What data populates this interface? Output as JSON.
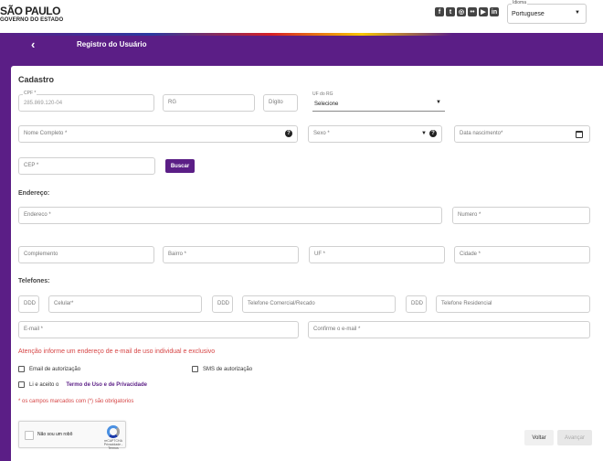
{
  "header": {
    "logo_line1": "SÃO PAULO",
    "logo_line2": "GOVERNO DO ESTADO",
    "social_icons": [
      "facebook-icon",
      "twitter-icon",
      "instagram-icon",
      "flickr-icon",
      "youtube-icon",
      "linkedin-icon"
    ],
    "language_label": "Idioma",
    "language_value": "Portuguese"
  },
  "titlebar": {
    "back_glyph": "‹",
    "title": "Registro do Usuário"
  },
  "form": {
    "heading": "Cadastro",
    "cpf_label": "CPF *",
    "cpf_value": "285.869.120-04",
    "rg_placeholder": "RG",
    "digito_placeholder": "Dígito",
    "uf_rg_label": "UF do RG",
    "uf_rg_value": "Selecione",
    "nome_placeholder": "Nome Completo *",
    "sexo_placeholder": "Sexo *",
    "nascimento_placeholder": "Data nascimento*",
    "cep_placeholder": "CEP *",
    "buscar_label": "Buscar",
    "endereco_heading": "Endereço:",
    "endereco_placeholder": "Endereco *",
    "numero_placeholder": "Numero *",
    "complemento_placeholder": "Complemento",
    "bairro_placeholder": "Bairro *",
    "uf_placeholder": "UF *",
    "cidade_placeholder": "Cidade *",
    "telefones_heading": "Telefones:",
    "ddd_placeholder": "DDD",
    "celular_placeholder": "Celular*",
    "comercial_placeholder": "Telefone Comercial/Recado",
    "residencial_placeholder": "Telefone Residencial",
    "email_placeholder": "E-mail *",
    "confirm_email_placeholder": "Confirme o e-mail *",
    "email_warning": "Atenção informe um endereço de e-mail de uso individual e exclusivo",
    "email_auth_label": "Email de autorização",
    "sms_auth_label": "SMS de autorização",
    "terms_prefix": "Li e aceito o",
    "terms_link": "Termo de Uso e de Privacidade",
    "required_note": "* os campos marcados com (*) são obrigatorios"
  },
  "captcha": {
    "label": "Não sou um robô",
    "brand": "reCAPTCHA",
    "links": "Privacidade - Termos"
  },
  "actions": {
    "voltar": "Voltar",
    "avancar": "Avançar"
  }
}
